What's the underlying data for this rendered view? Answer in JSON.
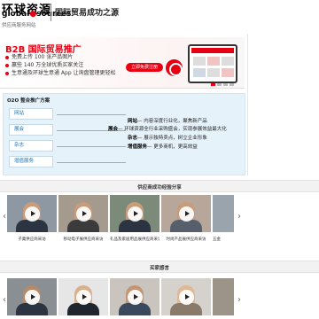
{
  "header": {
    "logo_cn": "环球资源",
    "logo_en_a": "global",
    "logo_en_b": "sources",
    "logo_sub": "供应商服务网站",
    "slogan": "国际贸易成功之源"
  },
  "banner": {
    "title": "B2B 国际贸易推广",
    "bullets": [
      "免费上传 100 张产品图片",
      "赢些 140 万全球优质买家关注",
      "生意通及环球生意通 App 让询盘管理更轻松"
    ],
    "cta": "立即免费注册"
  },
  "o2o": {
    "title": "O2O 整合推广方案",
    "buttons": [
      "网站",
      "展会",
      "杂志",
      "增值服务"
    ],
    "lines": [
      {
        "key": "网站",
        "text": "— 内容深度行业化，聚焦新产品"
      },
      {
        "key": "展会",
        "text": "— 环球资源全行业采购盛会，实现参展效益最大化"
      },
      {
        "key": "杂志",
        "text": "— 展示独特卖点，树立企业形象"
      },
      {
        "key": "增值服务",
        "text": "— 更多商机，更高效益"
      }
    ]
  },
  "sections": {
    "success": "供应商成功经验分享",
    "buyers": "买家感言"
  },
  "videos_row1": [
    {
      "title": "子菓供应商采访"
    },
    {
      "title": "移动电子展供应商采访"
    },
    {
      "title": "礼品及家居用品展供应商采访"
    },
    {
      "title": "时尚产品展供应商采访"
    },
    {
      "title": "五金"
    }
  ],
  "videos_row2": [
    {
      "title": ""
    },
    {
      "title": ""
    },
    {
      "title": ""
    },
    {
      "title": ""
    },
    {
      "title": ""
    }
  ],
  "carousel": {
    "prev_icon": "chevron-left-icon",
    "next_icon": "chevron-right-icon",
    "prev_glyph": "‹",
    "next_glyph": "›"
  },
  "colors": {
    "brand_red": "#e60012",
    "o2o_bg": "#e6f2fa",
    "link_blue": "#1d6fb0"
  }
}
